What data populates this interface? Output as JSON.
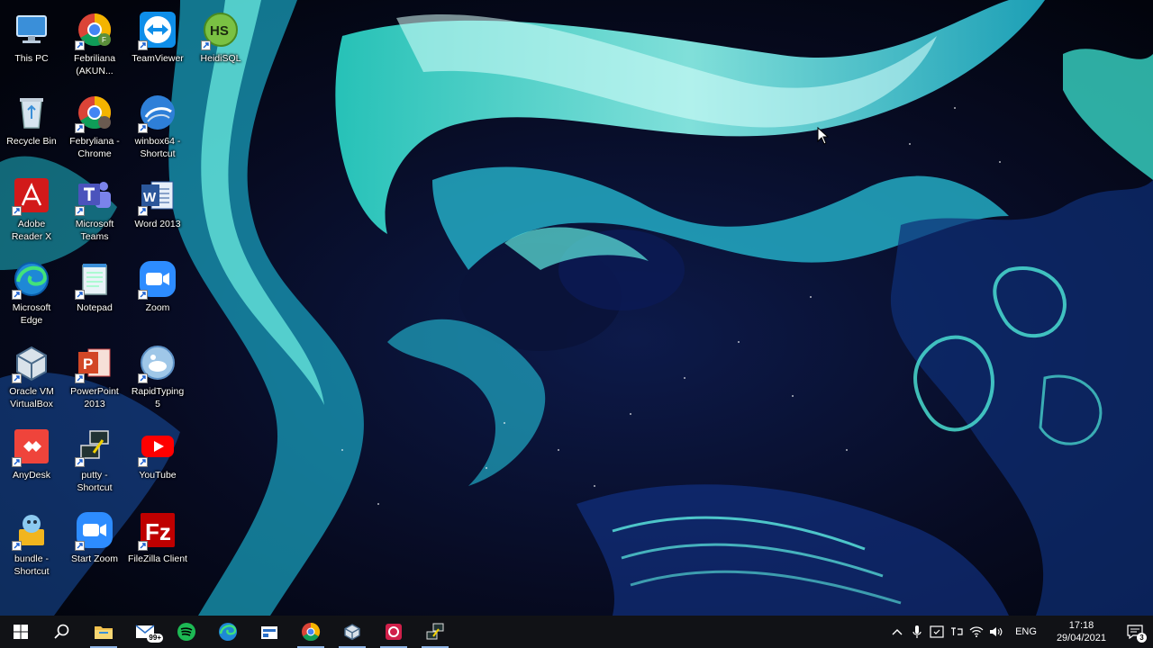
{
  "desktop": {
    "icons": [
      {
        "label": "This PC",
        "icon": "computer-icon"
      },
      {
        "label": "Febriliana (AKUN...",
        "icon": "chrome-icon"
      },
      {
        "label": "TeamViewer",
        "icon": "teamviewer-icon"
      },
      {
        "label": "HeidiSQL",
        "icon": "heidisql-icon"
      },
      {
        "label": "Recycle Bin",
        "icon": "recycle-bin-icon"
      },
      {
        "label": "Febryliana - Chrome",
        "icon": "chrome-icon"
      },
      {
        "label": "winbox64 - Shortcut",
        "icon": "winbox-icon"
      },
      {
        "label": "Adobe Reader X",
        "icon": "adobe-reader-icon"
      },
      {
        "label": "Microsoft Teams",
        "icon": "teams-icon"
      },
      {
        "label": "Word 2013",
        "icon": "word-icon"
      },
      {
        "label": "Microsoft Edge",
        "icon": "edge-icon"
      },
      {
        "label": "Notepad",
        "icon": "notepad-icon"
      },
      {
        "label": "Zoom",
        "icon": "zoom-icon"
      },
      {
        "label": "Oracle VM VirtualBox",
        "icon": "virtualbox-icon"
      },
      {
        "label": "PowerPoint 2013",
        "icon": "powerpoint-icon"
      },
      {
        "label": "RapidTyping 5",
        "icon": "rapidtyping-icon"
      },
      {
        "label": "AnyDesk",
        "icon": "anydesk-icon"
      },
      {
        "label": "putty - Shortcut",
        "icon": "putty-icon"
      },
      {
        "label": "YouTube",
        "icon": "youtube-icon"
      },
      {
        "label": "bundle - Shortcut",
        "icon": "bundle-icon"
      },
      {
        "label": "Start Zoom",
        "icon": "zoom-icon"
      },
      {
        "label": "FileZilla Client",
        "icon": "filezilla-icon"
      }
    ]
  },
  "taskbar": {
    "mail_badge": "99+",
    "language": "ENG",
    "time": "17:18",
    "date": "29/04/2021",
    "notification_count": "3"
  },
  "colors": {
    "taskbar_bg": "#111216",
    "wallpaper_cyan": "#3fe0d0",
    "wallpaper_blue": "#1a3a8a"
  }
}
